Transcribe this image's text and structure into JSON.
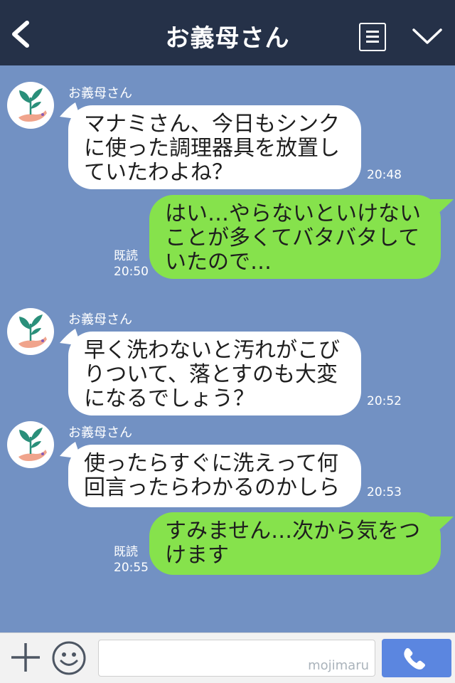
{
  "header": {
    "title": "お義母さん",
    "icons": {
      "back": "chevron-left-icon",
      "menu": "list-icon",
      "more": "chevron-down-icon"
    }
  },
  "messages": [
    {
      "type": "incoming",
      "sender": "お義母さん",
      "text": "マナミさん、今日もシンク\nに使った調理器具を放置し\nていたわよね？",
      "time": "20:48"
    },
    {
      "type": "outgoing",
      "read": "既読",
      "time": "20:50",
      "text": "はい…やらないといけない\nことが多くてバタバタして\nいたので…"
    },
    {
      "type": "incoming",
      "sender": "お義母さん",
      "text": "早く洗わないと汚れがこび\nりついて、落とすのも大変\nになるでしょう？",
      "time": "20:52"
    },
    {
      "type": "incoming",
      "sender": "お義母さん",
      "text": "使ったらすぐに洗えって何\n回言ったらわかるのかしら",
      "time": "20:53"
    },
    {
      "type": "outgoing",
      "read": "既読",
      "time": "20:55",
      "text": "すみません…次から気をつ\nけます"
    }
  ],
  "footer": {
    "input_value": "",
    "watermark": "mojimaru",
    "icons": {
      "add": "plus-icon",
      "emoji": "smiley-icon",
      "call": "phone-icon"
    }
  },
  "colors": {
    "header_bg": "#253148",
    "chat_bg": "#7291c3",
    "incoming_bubble": "#ffffff",
    "outgoing_bubble": "#86e24c",
    "call_button": "#5b86e0"
  }
}
